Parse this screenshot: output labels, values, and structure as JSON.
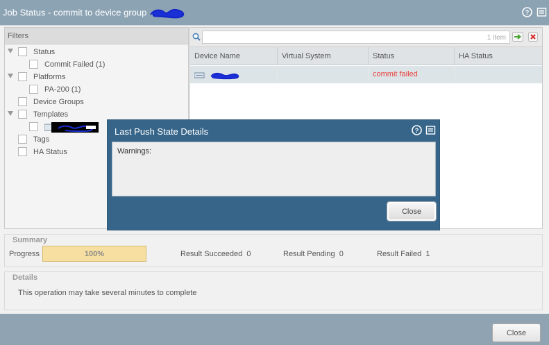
{
  "window": {
    "title": "Job Status - commit to device group"
  },
  "filters": {
    "header": "Filters",
    "status": {
      "label": "Status",
      "children": [
        "Commit Failed (1)"
      ]
    },
    "platforms": {
      "label": "Platforms",
      "children": [
        "PA-200 (1)"
      ]
    },
    "device_groups": {
      "label": "Device Groups"
    },
    "templates": {
      "label": "Templates"
    },
    "tags": {
      "label": "Tags"
    },
    "ha_status": {
      "label": "HA Status"
    }
  },
  "grid": {
    "search": {
      "value": "",
      "placeholder": ""
    },
    "item_count": "1 item",
    "columns": [
      "Device Name",
      "Virtual System",
      "Status",
      "HA Status"
    ],
    "rows": [
      {
        "device_name": "",
        "virtual_system": "",
        "status": "commit failed",
        "ha_status": ""
      }
    ]
  },
  "summary": {
    "title": "Summary",
    "progress_label": "Progress",
    "progress_value": 100,
    "progress_text": "100%",
    "succeeded_label": "Result Succeeded",
    "succeeded_value": "0",
    "pending_label": "Result Pending",
    "pending_value": "0",
    "failed_label": "Result Failed",
    "failed_value": "1"
  },
  "details": {
    "title": "Details",
    "text": "This operation may take several minutes to complete"
  },
  "modal": {
    "title": "Last Push State Details",
    "content": "Warnings:",
    "close_label": "Close"
  },
  "footer": {
    "close_label": "Close"
  },
  "colors": {
    "titlebar": "#8ca3b4",
    "modal": "#376589",
    "status_failed": "#e8403a",
    "progress": "#f6dfa0"
  },
  "icons": [
    "help-icon",
    "maximize-icon",
    "search-icon",
    "apply-filter-icon",
    "clear-filter-icon",
    "device-icon",
    "template-icon",
    "collapse-triangle-icon"
  ]
}
